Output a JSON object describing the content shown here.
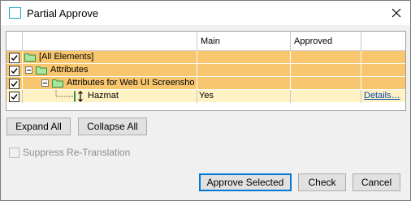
{
  "window": {
    "title": "Partial Approve",
    "close_label": "✕"
  },
  "grid": {
    "columns": [
      "",
      "",
      "Main",
      "Approved",
      ""
    ],
    "rows": [
      {
        "checked": true,
        "label": "[All Elements]",
        "main": "",
        "approved": "",
        "link": ""
      },
      {
        "checked": true,
        "label": "Attributes",
        "main": "",
        "approved": "",
        "link": ""
      },
      {
        "checked": true,
        "label": "Attributes for Web UI Screensho",
        "main": "",
        "approved": "",
        "link": ""
      },
      {
        "checked": true,
        "label": "Hazmat",
        "main": "Yes",
        "approved": "",
        "link": "Details…"
      }
    ]
  },
  "buttons": {
    "expand_all": "Expand All",
    "collapse_all": "Collapse All",
    "approve_selected": "Approve Selected",
    "check": "Check",
    "cancel": "Cancel"
  },
  "options": {
    "suppress_retranslation": "Suppress Re-Translation"
  },
  "colors": {
    "parent_row": "#f8c66e",
    "leaf_row": "#fff2c4",
    "accent": "#0078d7"
  }
}
